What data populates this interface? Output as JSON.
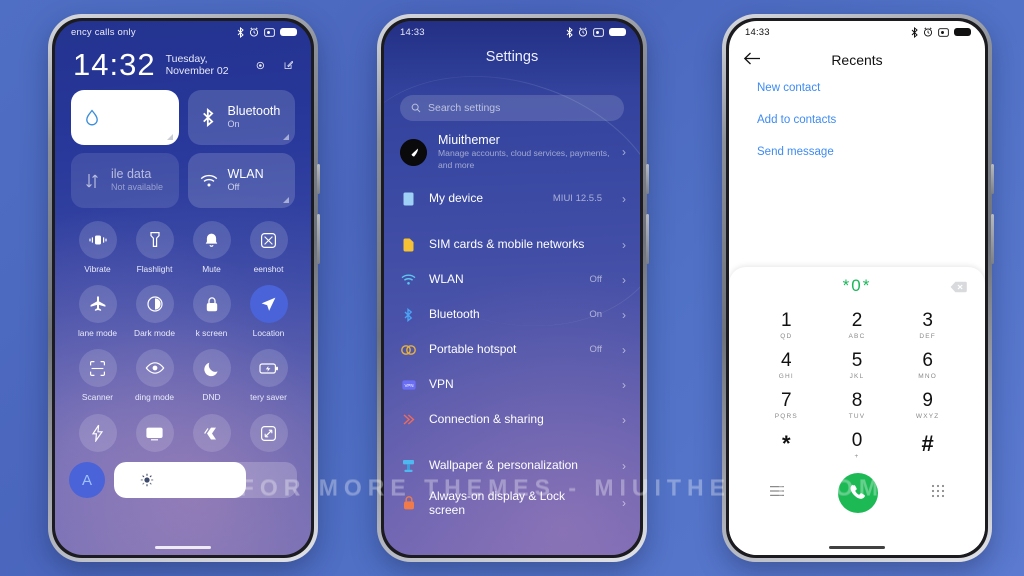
{
  "watermark": "VISIT FOR MORE THEMES   -   MIUITHEMER.COM",
  "phone1": {
    "status": {
      "carrier": "ency calls only",
      "icons": [
        "bluetooth-icon",
        "alarm-icon",
        "dnd-icon",
        "battery-icon"
      ]
    },
    "lockscreen": {
      "time": "14:32",
      "date": "Tuesday, November 02"
    },
    "big_tiles": [
      {
        "name": "water-drop",
        "title": "",
        "sub": "",
        "style": "on-white"
      },
      {
        "name": "bluetooth",
        "title": "Bluetooth",
        "sub": "On",
        "style": "on"
      },
      {
        "name": "mobile-data",
        "title": "ile data",
        "sub": "Not available",
        "style": "dim"
      },
      {
        "name": "wlan",
        "title": "WLAN",
        "sub": "Off",
        "style": "on"
      }
    ],
    "toggles": [
      {
        "label": "Vibrate",
        "icon": "vibrate-icon",
        "active": false
      },
      {
        "label": "Flashlight",
        "icon": "flashlight-icon",
        "active": false
      },
      {
        "label": "Mute",
        "icon": "bell-icon",
        "active": false
      },
      {
        "label": "eenshot",
        "icon": "screenshot-icon",
        "active": false
      },
      {
        "label": "lane mode",
        "icon": "airplane-icon",
        "active": false
      },
      {
        "label": "Dark mode",
        "icon": "contrast-icon",
        "active": false
      },
      {
        "label": "k screen",
        "icon": "lock-icon",
        "active": false
      },
      {
        "label": "Location",
        "icon": "location-icon",
        "active": true
      },
      {
        "label": "Scanner",
        "icon": "scan-icon",
        "active": false
      },
      {
        "label": "ding mode",
        "icon": "eye-icon",
        "active": false
      },
      {
        "label": "DND",
        "icon": "moon-icon",
        "active": false
      },
      {
        "label": "tery saver",
        "icon": "battery-saver-icon",
        "active": false
      }
    ],
    "toggles_row4": [
      {
        "label": "",
        "icon": "lightning-icon",
        "active": false
      },
      {
        "label": "",
        "icon": "cast-icon",
        "active": false
      },
      {
        "label": "",
        "icon": "theme-icon",
        "active": false
      },
      {
        "label": "",
        "icon": "rotate-icon",
        "active": false
      }
    ],
    "brightness": {
      "auto_label": "A",
      "value_percent": 72
    }
  },
  "phone2": {
    "status": {
      "time": "14:33",
      "icons": [
        "bluetooth-icon",
        "alarm-icon",
        "dnd-icon",
        "battery-icon"
      ]
    },
    "title": "Settings",
    "search_placeholder": "Search settings",
    "account": {
      "name": "Miuithemer",
      "desc": "Manage accounts, cloud services, payments, and more"
    },
    "rows_group1": [
      {
        "label": "My device",
        "value": "MIUI 12.5.5",
        "icon": "device-icon",
        "color": "#9fd0f5"
      }
    ],
    "rows_group2": [
      {
        "label": "SIM cards & mobile networks",
        "value": "",
        "icon": "sim-icon",
        "color": "#f5c135"
      },
      {
        "label": "WLAN",
        "value": "Off",
        "icon": "wifi-icon",
        "color": "#5fc5f0"
      },
      {
        "label": "Bluetooth",
        "value": "On",
        "icon": "bluetooth-icon",
        "color": "#4aa3f5"
      },
      {
        "label": "Portable hotspot",
        "value": "Off",
        "icon": "hotspot-icon",
        "color": "#e8b23c"
      },
      {
        "label": "VPN",
        "value": "",
        "icon": "vpn-icon",
        "color": "#6a6ef5"
      },
      {
        "label": "Connection & sharing",
        "value": "",
        "icon": "share-icon",
        "color": "#f06a5a"
      }
    ],
    "rows_group3": [
      {
        "label": "Wallpaper & personalization",
        "value": "",
        "icon": "wallpaper-icon",
        "color": "#4fb8f0"
      },
      {
        "label": "Always-on display & Lock screen",
        "value": "",
        "icon": "lock-icon",
        "color": "#f07a4a"
      }
    ]
  },
  "phone3": {
    "status": {
      "time": "14:33",
      "icons": [
        "bluetooth-icon",
        "alarm-icon",
        "dnd-icon",
        "battery-icon"
      ]
    },
    "title": "Recents",
    "back_icon": "arrow-left-icon",
    "links": [
      "New contact",
      "Add to contacts",
      "Send message"
    ],
    "dialed_number": "*0*",
    "keys": [
      {
        "digit": "1",
        "letters": "QD"
      },
      {
        "digit": "2",
        "letters": "ABC"
      },
      {
        "digit": "3",
        "letters": "DEF"
      },
      {
        "digit": "4",
        "letters": "GHI"
      },
      {
        "digit": "5",
        "letters": "JKL"
      },
      {
        "digit": "6",
        "letters": "MNO"
      },
      {
        "digit": "7",
        "letters": "PQRS"
      },
      {
        "digit": "8",
        "letters": "TUV"
      },
      {
        "digit": "9",
        "letters": "WXYZ"
      },
      {
        "digit": "*",
        "letters": ""
      },
      {
        "digit": "0",
        "letters": "+"
      },
      {
        "digit": "#",
        "letters": ""
      }
    ],
    "bottom": {
      "menu_icon": "menu-icon",
      "call_icon": "call-icon",
      "keypad_icon": "keypad-icon"
    }
  },
  "colors": {
    "accent_blue": "#4a63d8",
    "link_blue": "#3d8bf2",
    "call_green": "#1cb955",
    "dial_green": "#1ab759"
  }
}
